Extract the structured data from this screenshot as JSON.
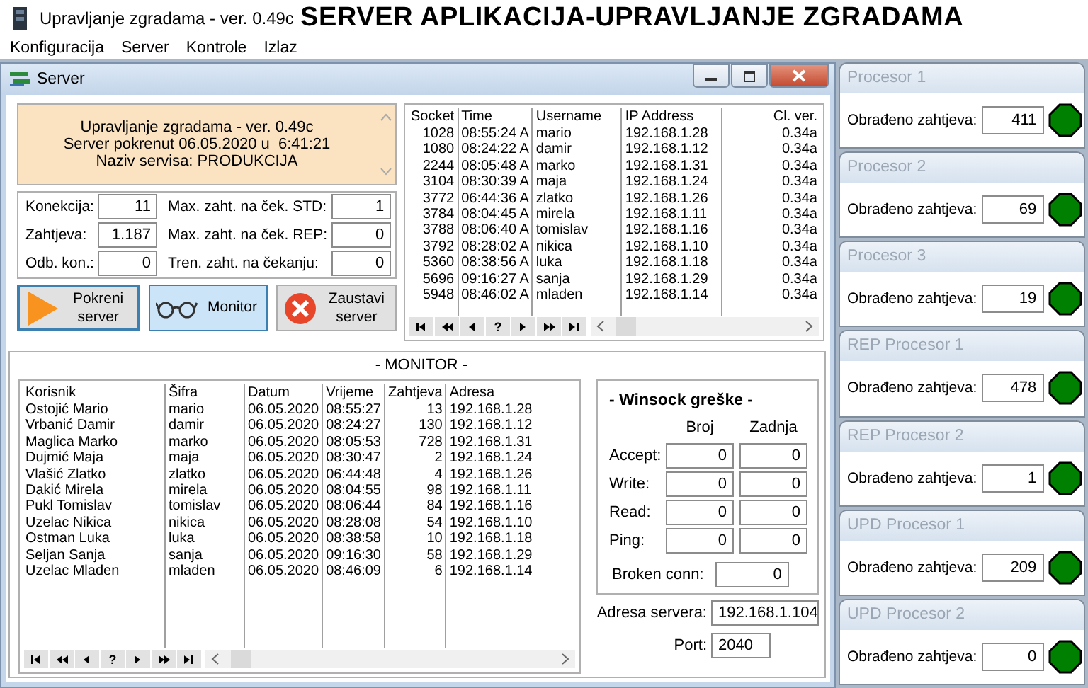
{
  "app": {
    "title": "Upravljanje zgradama - ver. 0.49c",
    "banner": "SERVER APLIKACIJA-UPRAVLJANJE ZGRADAMA"
  },
  "menu": [
    "Konfiguracija",
    "Server",
    "Kontrole",
    "Izlaz"
  ],
  "server_window": {
    "title": "Server",
    "info_lines": [
      "Upravljanje zgradama - ver. 0.49c",
      "Server pokrenut 06.05.2020 u  6:41:21",
      "Naziv servisa: PRODUKCIJA"
    ],
    "stats": [
      {
        "label": "Konekcija:",
        "value": "11"
      },
      {
        "label": "Max. zaht. na ček. STD:",
        "value": "1"
      },
      {
        "label": "Zahtjeva:",
        "value": "1.187"
      },
      {
        "label": "Max. zaht. na ček. REP:",
        "value": "0"
      },
      {
        "label": "Odb. kon.:",
        "value": "0"
      },
      {
        "label": "Tren. zaht. na čekanju:",
        "value": "0"
      }
    ],
    "buttons": [
      {
        "label": "Pokreni server",
        "kind": "start",
        "selected": false
      },
      {
        "label": "Monitor",
        "kind": "monitor",
        "selected": true
      },
      {
        "label": "Zaustavi server",
        "kind": "stop",
        "selected": false
      }
    ],
    "sessions": {
      "columns": [
        "Socket",
        "Time",
        "Username",
        "IP Address",
        "Cl. ver."
      ],
      "rows": [
        [
          "1028",
          "08:55:24 A",
          "mario",
          "192.168.1.28",
          "0.34a"
        ],
        [
          "1080",
          "08:24:22 A",
          "damir",
          "192.168.1.12",
          "0.34a"
        ],
        [
          "2244",
          "08:05:48 A",
          "marko",
          "192.168.1.31",
          "0.34a"
        ],
        [
          "3104",
          "08:30:39 A",
          "maja",
          "192.168.1.24",
          "0.34a"
        ],
        [
          "3772",
          "06:44:36 A",
          "zlatko",
          "192.168.1.26",
          "0.34a"
        ],
        [
          "3784",
          "08:04:45 A",
          "mirela",
          "192.168.1.11",
          "0.34a"
        ],
        [
          "3788",
          "08:06:40 A",
          "tomislav",
          "192.168.1.16",
          "0.34a"
        ],
        [
          "3792",
          "08:28:02 A",
          "nikica",
          "192.168.1.10",
          "0.34a"
        ],
        [
          "5360",
          "08:38:56 A",
          "luka",
          "192.168.1.18",
          "0.34a"
        ],
        [
          "5696",
          "09:16:27 A",
          "sanja",
          "192.168.1.29",
          "0.34a"
        ],
        [
          "5948",
          "08:46:02 A",
          "mladen",
          "192.168.1.14",
          "0.34a"
        ]
      ],
      "navigator": [
        {
          "kind": "first"
        },
        {
          "kind": "prior-page"
        },
        {
          "kind": "prior"
        },
        {
          "kind": "text",
          "label": "?"
        },
        {
          "kind": "next"
        },
        {
          "kind": "next-page"
        },
        {
          "kind": "last"
        }
      ]
    },
    "monitor": {
      "title": "- MONITOR -",
      "columns": [
        "Korisnik",
        "Šifra",
        "Datum",
        "Vrijeme",
        "Zahtjeva",
        "Adresa"
      ],
      "rows": [
        [
          "Ostojić Mario",
          "mario",
          "06.05.2020",
          "08:55:27",
          "13",
          "192.168.1.28"
        ],
        [
          "Vrbanić Damir",
          "damir",
          "06.05.2020",
          "08:24:27",
          "130",
          "192.168.1.12"
        ],
        [
          "Maglica Marko",
          "marko",
          "06.05.2020",
          "08:05:53",
          "728",
          "192.168.1.31"
        ],
        [
          "Dujmić Maja",
          "maja",
          "06.05.2020",
          "08:30:47",
          "2",
          "192.168.1.24"
        ],
        [
          "Vlašić Zlatko",
          "zlatko",
          "06.05.2020",
          "06:44:48",
          "4",
          "192.168.1.26"
        ],
        [
          "Dakić Mirela",
          "mirela",
          "06.05.2020",
          "08:04:55",
          "98",
          "192.168.1.11"
        ],
        [
          "Pukl Tomislav",
          "tomislav",
          "06.05.2020",
          "08:06:44",
          "84",
          "192.168.1.16"
        ],
        [
          "Uzelac Nikica",
          "nikica",
          "06.05.2020",
          "08:28:08",
          "54",
          "192.168.1.10"
        ],
        [
          "Ostman Luka",
          "luka",
          "06.05.2020",
          "08:38:58",
          "10",
          "192.168.1.18"
        ],
        [
          "Seljan Sanja",
          "sanja",
          "06.05.2020",
          "09:16:30",
          "58",
          "192.168.1.29"
        ],
        [
          "Uzelac Mladen",
          "mladen",
          "06.05.2020",
          "08:46:09",
          "6",
          "192.168.1.14"
        ]
      ],
      "navigator": [
        {
          "kind": "first"
        },
        {
          "kind": "prior-page"
        },
        {
          "kind": "prior"
        },
        {
          "kind": "text",
          "label": "?"
        },
        {
          "kind": "next"
        },
        {
          "kind": "next-page"
        },
        {
          "kind": "last"
        }
      ]
    },
    "winsock": {
      "title": "- Winsock greške -",
      "columns": [
        "Broj",
        "Zadnja"
      ],
      "rows": [
        {
          "label": "Accept:",
          "count": "0",
          "last": "0"
        },
        {
          "label": "Write:",
          "count": "0",
          "last": "0"
        },
        {
          "label": "Read:",
          "count": "0",
          "last": "0"
        },
        {
          "label": "Ping:",
          "count": "0",
          "last": "0"
        }
      ],
      "broken": {
        "label": "Broken conn:",
        "value": "0"
      }
    },
    "server_address": {
      "label": "Adresa servera:",
      "value": "192.168.1.104"
    },
    "port": {
      "label": "Port:",
      "value": "2040"
    }
  },
  "processors": [
    {
      "title": "Procesor 1",
      "label": "Obrađeno zahtjeva:",
      "value": "411",
      "color": "#008000"
    },
    {
      "title": "Procesor 2",
      "label": "Obrađeno zahtjeva:",
      "value": "69",
      "color": "#008000"
    },
    {
      "title": "Procesor 3",
      "label": "Obrađeno zahtjeva:",
      "value": "19",
      "color": "#008000"
    },
    {
      "title": "REP Procesor 1",
      "label": "Obrađeno zahtjeva:",
      "value": "478",
      "color": "#008000"
    },
    {
      "title": "REP Procesor 2",
      "label": "Obrađeno zahtjeva:",
      "value": "1",
      "color": "#008000"
    },
    {
      "title": "UPD Procesor 1",
      "label": "Obrađeno zahtjeva:",
      "value": "209",
      "color": "#008000"
    },
    {
      "title": "UPD Procesor 2",
      "label": "Obrađeno zahtjeva:",
      "value": "0",
      "color": "#008000"
    }
  ]
}
